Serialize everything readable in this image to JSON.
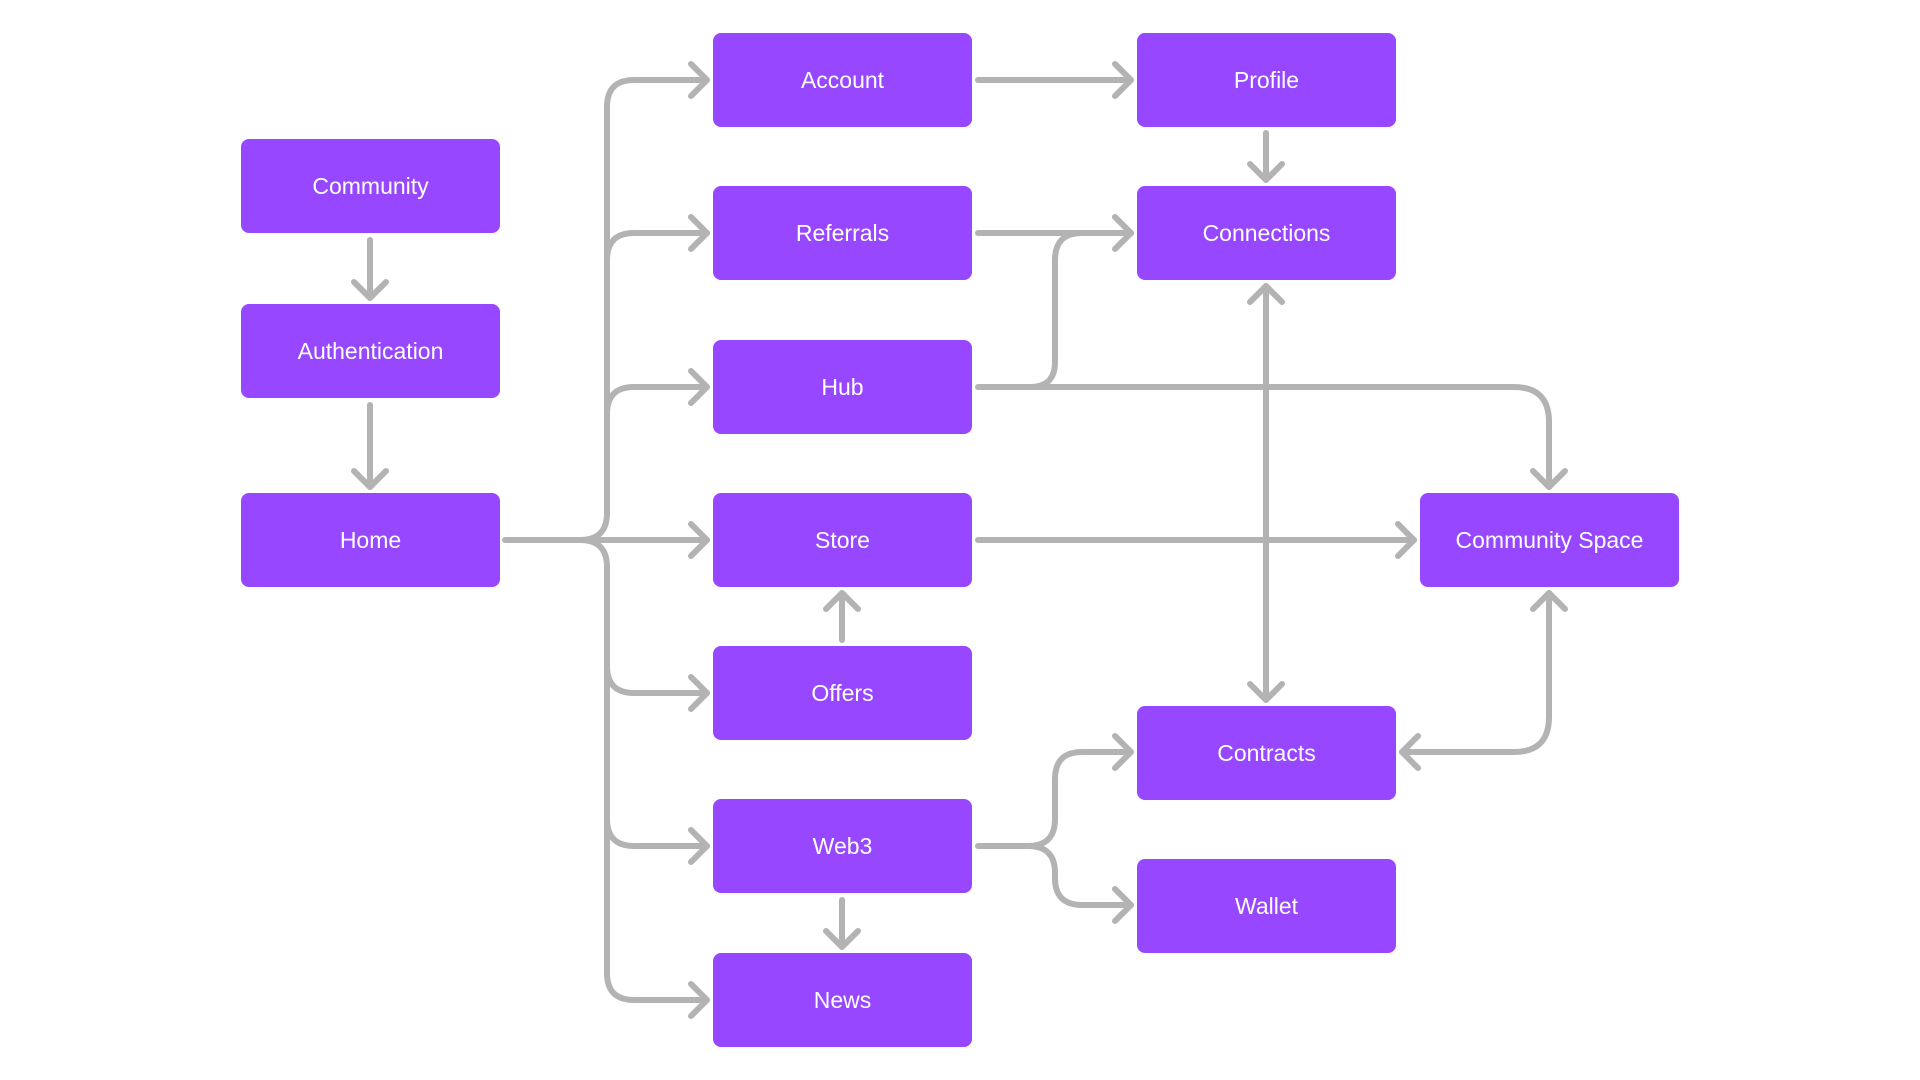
{
  "diagram": {
    "accent_color": "#9747ff",
    "edge_color": "#b3b3b3",
    "nodes": {
      "community": "Community",
      "authentication": "Authentication",
      "home": "Home",
      "account": "Account",
      "referrals": "Referrals",
      "hub": "Hub",
      "store": "Store",
      "offers": "Offers",
      "web3": "Web3",
      "news": "News",
      "profile": "Profile",
      "connections": "Connections",
      "contracts": "Contracts",
      "wallet": "Wallet",
      "community_space": "Community Space"
    },
    "edges": [
      {
        "from": "Community",
        "to": "Authentication"
      },
      {
        "from": "Authentication",
        "to": "Home"
      },
      {
        "from": "Home",
        "to": "Account"
      },
      {
        "from": "Home",
        "to": "Referrals"
      },
      {
        "from": "Home",
        "to": "Hub"
      },
      {
        "from": "Home",
        "to": "Store"
      },
      {
        "from": "Home",
        "to": "Offers"
      },
      {
        "from": "Home",
        "to": "Web3"
      },
      {
        "from": "Home",
        "to": "News"
      },
      {
        "from": "Account",
        "to": "Profile"
      },
      {
        "from": "Profile",
        "to": "Connections"
      },
      {
        "from": "Referrals",
        "to": "Connections"
      },
      {
        "from": "Hub",
        "to": "Connections"
      },
      {
        "from": "Hub",
        "to": "Community Space"
      },
      {
        "from": "Store",
        "to": "Community Space"
      },
      {
        "from": "Offers",
        "to": "Store"
      },
      {
        "from": "Web3",
        "to": "News"
      },
      {
        "from": "Web3",
        "to": "Contracts"
      },
      {
        "from": "Web3",
        "to": "Wallet"
      },
      {
        "from": "Connections",
        "to": "Contracts",
        "bidirectional": true
      },
      {
        "from": "Contracts",
        "to": "Community Space",
        "bidirectional": true
      }
    ]
  }
}
